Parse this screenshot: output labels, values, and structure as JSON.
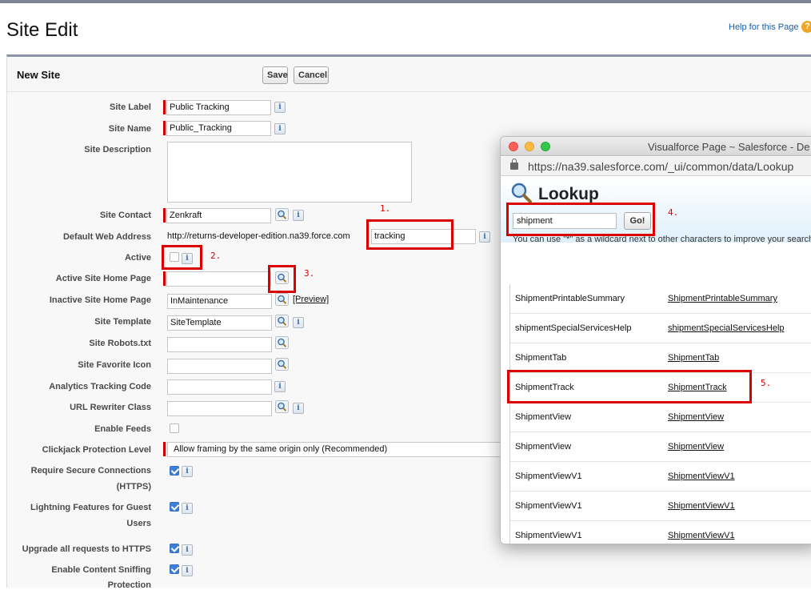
{
  "page": {
    "title": "Site Edit",
    "help_link": "Help for this Page",
    "help_icon": "question-icon"
  },
  "section": {
    "title": "New Site",
    "save_label": "Save",
    "cancel_label": "Cancel"
  },
  "fields": {
    "site_label": {
      "label": "Site Label",
      "value": "Public Tracking"
    },
    "site_name": {
      "label": "Site Name",
      "value": "Public_Tracking"
    },
    "site_description": {
      "label": "Site Description",
      "value": ""
    },
    "site_contact": {
      "label": "Site Contact",
      "value": "Zenkraft"
    },
    "default_web_address": {
      "label": "Default Web Address",
      "prefix": "http://returns-developer-edition.na39.force.com",
      "value": "tracking"
    },
    "active": {
      "label": "Active",
      "checked": false
    },
    "active_home": {
      "label": "Active Site Home Page",
      "value": ""
    },
    "inactive_home": {
      "label": "Inactive Site Home Page",
      "value": "InMaintenance",
      "preview": "[Preview]"
    },
    "site_template": {
      "label": "Site Template",
      "value": "SiteTemplate"
    },
    "robots": {
      "label": "Site Robots.txt",
      "value": ""
    },
    "favicon": {
      "label": "Site Favorite Icon",
      "value": ""
    },
    "analytics": {
      "label": "Analytics Tracking Code",
      "value": ""
    },
    "url_rewriter": {
      "label": "URL Rewriter Class",
      "value": ""
    },
    "enable_feeds": {
      "label": "Enable Feeds",
      "checked": false
    },
    "clickjack": {
      "label": "Clickjack Protection Level",
      "value": "Allow framing by the same origin only (Recommended)"
    },
    "secure_connections": {
      "label1": "Require Secure Connections",
      "label2": "(HTTPS)",
      "checked": true
    },
    "lightning": {
      "label1": "Lightning Features for Guest",
      "label2": "Users",
      "checked": true
    },
    "upgrade_https": {
      "label": "Upgrade all requests to HTTPS",
      "checked": true
    },
    "content_sniffing": {
      "label1": "Enable Content Sniffing",
      "label2": "Protection",
      "checked": true
    }
  },
  "annotations": {
    "a1": "1.",
    "a2": "2.",
    "a3": "3.",
    "a4": "4.",
    "a5": "5."
  },
  "popup": {
    "window_title": "Visualforce Page ~ Salesforce - De",
    "url": "https://na39.salesforce.com/_ui/common/data/Lookup",
    "heading": "Lookup",
    "search_value": "shipment",
    "go_label": "Go!",
    "hint": "You can use \"*\" as a wildcard next to other characters to improve your search r",
    "results": [
      {
        "name": "ShipmentPrintableSummary",
        "link": "ShipmentPrintableSummary"
      },
      {
        "name": "shipmentSpecialServicesHelp",
        "link": "shipmentSpecialServicesHelp"
      },
      {
        "name": "ShipmentTab",
        "link": "ShipmentTab"
      },
      {
        "name": "ShipmentTrack",
        "link": "ShipmentTrack"
      },
      {
        "name": "ShipmentView",
        "link": "ShipmentView"
      },
      {
        "name": "ShipmentView",
        "link": "ShipmentView"
      },
      {
        "name": "ShipmentViewV1",
        "link": "ShipmentViewV1"
      },
      {
        "name": "ShipmentViewV1",
        "link": "ShipmentViewV1"
      },
      {
        "name": "ShipmentViewV1",
        "link": "ShipmentViewV1"
      }
    ]
  },
  "colors": {
    "required": "#cc0000",
    "annotation": "#dd0000",
    "link": "#1a5fa8"
  }
}
